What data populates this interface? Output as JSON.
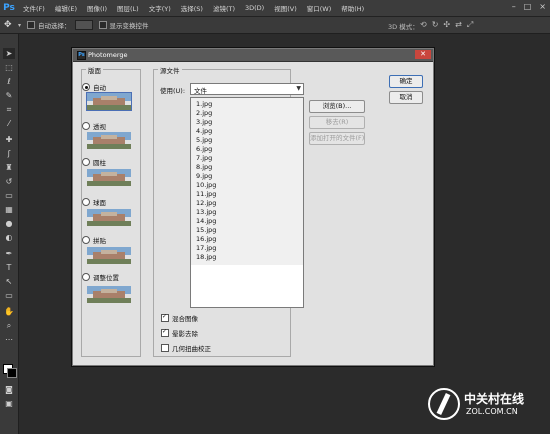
{
  "app": {
    "logo": "Ps",
    "menu": [
      "文件(F)",
      "编辑(E)",
      "图像(I)",
      "图层(L)",
      "文字(Y)",
      "选择(S)",
      "滤镜(T)",
      "3D(D)",
      "视图(V)",
      "窗口(W)",
      "帮助(H)"
    ],
    "window_controls": [
      "–",
      "□",
      "×"
    ]
  },
  "options_bar": {
    "auto_select_label": "自动选择：",
    "show_transform_label": "显示变换控件",
    "mode_3d_label": "3D 模式："
  },
  "dialog": {
    "title": "Photomerge",
    "layout": {
      "group_title": "版面",
      "selected": "自动",
      "options": [
        "自动",
        "透视",
        "圆柱",
        "球面",
        "拼贴",
        "调整位置"
      ]
    },
    "source": {
      "group_title": "源文件",
      "use_label": "使用(U):",
      "use_value": "文件",
      "files": [
        "1.jpg",
        "2.jpg",
        "3.jpg",
        "4.jpg",
        "5.jpg",
        "6.jpg",
        "7.jpg",
        "8.jpg",
        "9.jpg",
        "10.jpg",
        "11.jpg",
        "12.jpg",
        "13.jpg",
        "14.jpg",
        "15.jpg",
        "16.jpg",
        "17.jpg",
        "18.jpg"
      ],
      "browse_label": "浏览(B)...",
      "remove_label": "移去(R)",
      "add_open_label": "添加打开的文件(F)",
      "checks": [
        {
          "label": "混合图像",
          "checked": true
        },
        {
          "label": "晕影去除",
          "checked": true
        },
        {
          "label": "几何扭曲校正",
          "checked": false
        }
      ]
    },
    "ok_label": "确定",
    "cancel_label": "取消"
  },
  "watermark": {
    "cn": "中关村在线",
    "en": "ZOL.COM.CN"
  },
  "colors": {
    "workspace": "#2b2b2b",
    "panel": "#3a3a3a",
    "dialog_bg": "#e1e1e1",
    "ps_blue": "#3ba3ff"
  }
}
